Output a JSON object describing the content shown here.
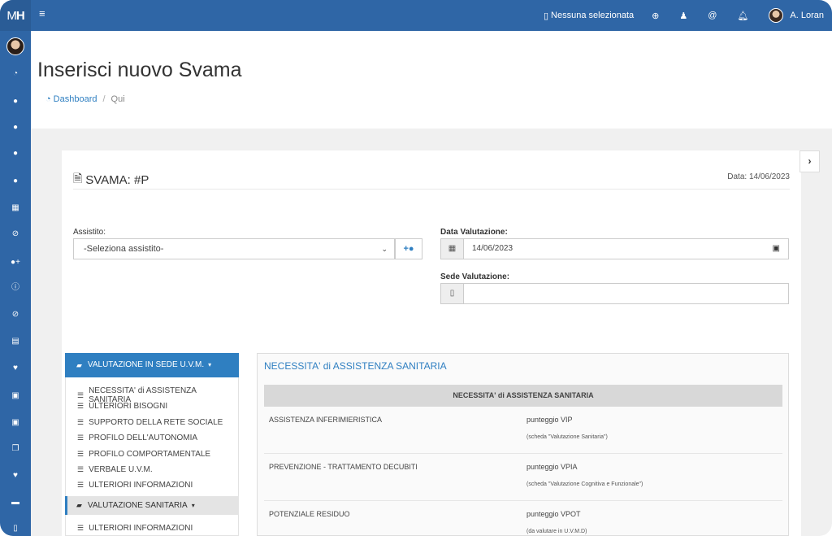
{
  "topbar": {
    "brand_m": "M",
    "brand_h": "H",
    "selection": "Nessuna selezionata",
    "user": "A. Loran"
  },
  "page": {
    "title": "Inserisci nuovo Svama",
    "breadcrumb": {
      "home": "Dashboard",
      "current": "Qui"
    }
  },
  "card": {
    "title": "SVAMA: #P",
    "date_text": "Data: 14/06/2023",
    "assistito_label": "Assistito:",
    "assistito_value": "-Seleziona assistito-",
    "data_valutazione_label": "Data Valutazione:",
    "data_valutazione_value": "14/06/2023",
    "sede_label": "Sede Valutazione:",
    "sede_value": ""
  },
  "tree": {
    "group1": "VALUTAZIONE IN SEDE U.V.M.",
    "items1": [
      "NECESSITA' di ASSISTENZA SANITARIA",
      "ULTERIORI BISOGNI",
      "SUPPORTO DELLA RETE SOCIALE",
      "PROFILO DELL'AUTONOMIA",
      "PROFILO COMPORTAMENTALE",
      "VERBALE U.V.M.",
      "ULTERIORI INFORMAZIONI"
    ],
    "group2": "VALUTAZIONE SANITARIA",
    "items2": [
      "ULTERIORI INFORMAZIONI"
    ]
  },
  "panel": {
    "title": "NECESSITA' di ASSISTENZA SANITARIA",
    "table_header": "NECESSITA' di ASSISTENZA SANITARIA",
    "rows": [
      {
        "name": "ASSISTENZA INFERIMIERISTICA",
        "score": "punteggio VIP",
        "note": "(scheda \"Valutazione Sanitaria\")"
      },
      {
        "name": "PREVENZIONE - TRATTAMENTO DECUBITI",
        "score": "punteggio VPIA",
        "note": "(scheda \"Valutazione Cognitiva e Funzionale\")"
      },
      {
        "name": "POTENZIALE RESIDUO",
        "score": "punteggio VPOT",
        "note": "(da valutare in U.V.M.D)"
      }
    ]
  },
  "icons": {
    "sidebar": [
      "dashboard-icon",
      "user-icon",
      "user-icon",
      "user-icon",
      "user-icon",
      "calendar-icon",
      "check-circle-icon",
      "user-plus-icon",
      "info-icon",
      "check-circle-icon",
      "file-icon",
      "heartbeat-icon",
      "medkit-icon",
      "medkit-icon",
      "copy-icon",
      "heartbeat-icon",
      "briefcase-icon",
      "building-icon"
    ]
  }
}
